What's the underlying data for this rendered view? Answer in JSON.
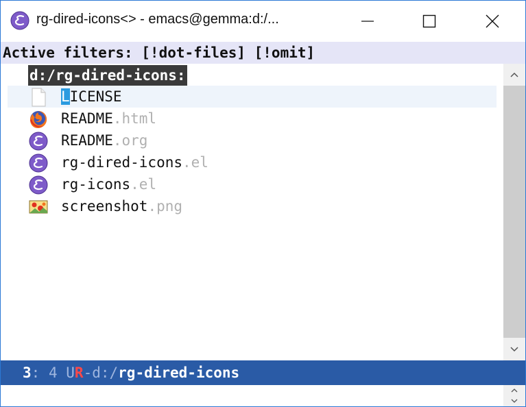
{
  "window": {
    "title": "rg-dired-icons<> - emacs@gemma:d:/...",
    "controls": [
      "minimize-icon",
      "maximize-icon",
      "close-icon"
    ]
  },
  "header_line": {
    "text": "Active filters: [!dot-files] [!omit]"
  },
  "buffer": {
    "directory": "d:/rg-dired-icons:",
    "files": [
      {
        "base": "LICENSE",
        "ext": "",
        "icon": "text-file-icon",
        "current": true
      },
      {
        "base": "README",
        "ext": ".html",
        "icon": "firefox-icon",
        "current": false
      },
      {
        "base": "README",
        "ext": ".org",
        "icon": "emacs-icon",
        "current": false
      },
      {
        "base": "rg-dired-icons",
        "ext": ".el",
        "icon": "emacs-icon",
        "current": false
      },
      {
        "base": "rg-icons",
        "ext": ".el",
        "icon": "emacs-icon",
        "current": false
      },
      {
        "base": "screenshot",
        "ext": ".png",
        "icon": "image-file-icon",
        "current": false
      }
    ]
  },
  "mode_line": {
    "line": "3",
    "colon": ":",
    "col": " 4 ",
    "u": "U",
    "r": "R",
    "dash": "-",
    "dir": "d:/",
    "buffer_name": "rg-dired-icons"
  },
  "colors": {
    "title_bar_border": "#2b78d6",
    "header_line_bg": "#e5e5f7",
    "mode_line_bg": "#2a5ba6",
    "cursor": "#2a9be0",
    "emacs_purple": "#7e5bc9"
  }
}
